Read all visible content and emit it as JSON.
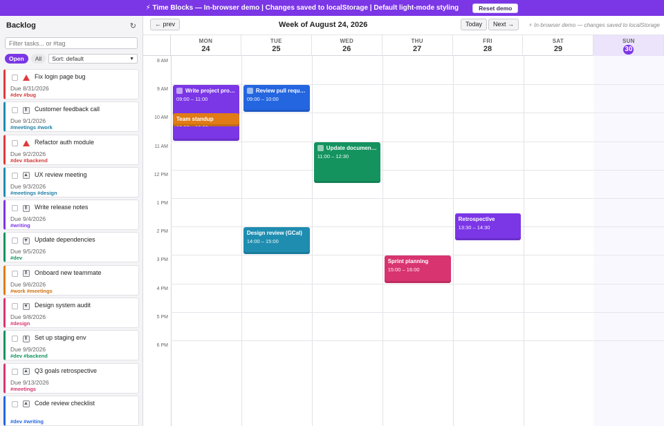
{
  "banner": {
    "text": "⚡ Time Blocks — In-browser demo  |  Changes saved to localStorage  |  Default light-mode styling",
    "reset_label": "Reset demo"
  },
  "sidebar": {
    "title": "Backlog",
    "refresh_glyph": "↻",
    "filter_placeholder": "Filter tasks... or #tag",
    "open_label": "Open",
    "all_label": "All",
    "sort_label": "Sort: default",
    "tasks": [
      {
        "title": "Fix login page bug",
        "due": "Due 8/31/2026",
        "tags": "#dev #bug",
        "color": "#e03a3a",
        "tag_color": "#d13838",
        "prio": "high"
      },
      {
        "title": "Customer feedback call",
        "due": "Due 9/1/2026",
        "tags": "#meetings #work",
        "color": "#1f8db0",
        "tag_color": "#1f7fa8",
        "prio": "low"
      },
      {
        "title": "Refactor auth module",
        "due": "Due 9/2/2026",
        "tags": "#dev #backend",
        "color": "#e03a3a",
        "tag_color": "#d13838",
        "prio": "high"
      },
      {
        "title": "UX review meeting",
        "due": "Due 9/3/2026",
        "tags": "#meetings #design",
        "color": "#1f8db0",
        "tag_color": "#1f7fa8",
        "prio": "med"
      },
      {
        "title": "Write release notes",
        "due": "Due 9/4/2026",
        "tags": "#writing",
        "color": "#7b36e6",
        "tag_color": "#7b36e6",
        "prio": "low"
      },
      {
        "title": "Update dependencies",
        "due": "Due 9/5/2026",
        "tags": "#dev",
        "color": "#14935f",
        "tag_color": "#14935f",
        "prio": "down"
      },
      {
        "title": "Onboard new teammate",
        "due": "Due 9/6/2026",
        "tags": "#work #meetings",
        "color": "#e07b16",
        "tag_color": "#d07012",
        "prio": "low"
      },
      {
        "title": "Design system audit",
        "due": "Due 9/8/2026",
        "tags": "#design",
        "color": "#d8346f",
        "tag_color": "#d8346f",
        "prio": "down"
      },
      {
        "title": "Set up staging env",
        "due": "Due 9/9/2026",
        "tags": "#dev #backend",
        "color": "#14935f",
        "tag_color": "#14935f",
        "prio": "low"
      },
      {
        "title": "Q3 goals retrospective",
        "due": "Due 9/13/2026",
        "tags": "#meetings",
        "color": "#d8346f",
        "tag_color": "#d8346f",
        "prio": "med"
      },
      {
        "title": "Code review checklist",
        "due": "",
        "tags": "#dev #writing",
        "color": "#2466e0",
        "tag_color": "#2466e0",
        "prio": "med"
      }
    ]
  },
  "calendar": {
    "prev_label": "← prev",
    "week_title": "Week of August 24, 2026",
    "today_label": "Today",
    "next_label": "Next →",
    "hint": "⚡ In-browser demo — changes saved to localStorage",
    "days": [
      {
        "name": "MON",
        "date": "24"
      },
      {
        "name": "TUE",
        "date": "25"
      },
      {
        "name": "WED",
        "date": "26"
      },
      {
        "name": "THU",
        "date": "27"
      },
      {
        "name": "FRI",
        "date": "28"
      },
      {
        "name": "SAT",
        "date": "29"
      },
      {
        "name": "SUN",
        "date": "30",
        "today": true
      }
    ],
    "hours": [
      "8 AM",
      "9 AM",
      "10 AM",
      "11 AM",
      "12 PM",
      "1 PM",
      "2 PM",
      "3 PM",
      "4 PM",
      "5 PM",
      "6 PM"
    ],
    "events": [
      {
        "title": "Write project pro…",
        "time": "09:00 – 11:00",
        "day": 0,
        "start": 9,
        "end": 11,
        "color": "#7b36e6",
        "checkbox": true
      },
      {
        "title": "Team standup",
        "time": "10:00 – 10:30",
        "day": 0,
        "start": 10,
        "end": 10.5,
        "color": "#e07b16",
        "checkbox": false
      },
      {
        "title": "Review pull requ…",
        "time": "09:00 – 10:00",
        "day": 1,
        "start": 9,
        "end": 10,
        "color": "#2466e0",
        "checkbox": true
      },
      {
        "title": "Update documen…",
        "time": "11:00 – 12:30",
        "day": 2,
        "start": 11,
        "end": 12.5,
        "color": "#14935f",
        "checkbox": true
      },
      {
        "title": "Design review (GCal)",
        "time": "14:00 – 15:00",
        "day": 1,
        "start": 14,
        "end": 15,
        "color": "#1f8db0",
        "checkbox": false
      },
      {
        "title": "Sprint planning",
        "time": "15:00 – 16:00",
        "day": 3,
        "start": 15,
        "end": 16,
        "color": "#d8346f",
        "checkbox": false
      },
      {
        "title": "Retrospective",
        "time": "13:30 – 14:30",
        "day": 4,
        "start": 13.5,
        "end": 14.5,
        "color": "#7b36e6",
        "checkbox": false
      }
    ]
  }
}
